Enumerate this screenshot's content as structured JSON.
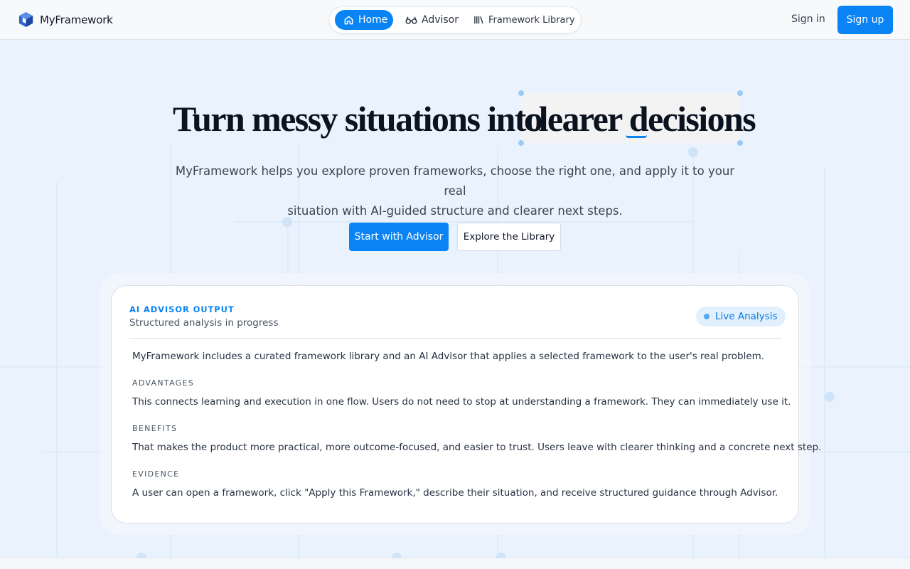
{
  "header": {
    "brand": "MyFramework",
    "nav": [
      {
        "label": "Home",
        "icon": "home-icon",
        "active": true
      },
      {
        "label": "Advisor",
        "icon": "glasses-icon",
        "active": false
      },
      {
        "label": "Framework Library",
        "icon": "library-icon",
        "active": false
      }
    ],
    "signin_label": "Sign in",
    "signup_label": "Sign up"
  },
  "hero": {
    "title_part1": "Turn messy situations into",
    "title_part2": "clearer decisions",
    "subtitle_line1": "MyFramework helps you explore proven frameworks, choose the right one, and apply it to your real",
    "subtitle_line2": "situation with AI-guided structure and clearer next steps.",
    "primary_cta": "Start with Advisor",
    "secondary_cta": "Explore the Library"
  },
  "advisor_card": {
    "kicker": "AI Advisor Output",
    "subtitle": "Structured analysis in progress",
    "badge": "Live Analysis",
    "intro": "MyFramework includes a curated framework library and an AI Advisor that applies a selected framework to the user's real problem.",
    "sections": [
      {
        "label": "Advantages",
        "text": "This connects learning and execution in one flow. Users do not need to stop at understanding a framework. They can immediately use it."
      },
      {
        "label": "Benefits",
        "text": "That makes the product more practical, more outcome-focused, and easier to trust. Users leave with clearer thinking and a concrete next step."
      },
      {
        "label": "Evidence",
        "text": "A user can open a framework, click \"Apply this Framework,\" describe their situation, and receive structured guidance through Advisor."
      }
    ]
  },
  "colors": {
    "accent": "#0a84f5",
    "background": "#eaf3fd",
    "badge_bg": "#e2f0fd",
    "text_dark": "#0b1320"
  }
}
